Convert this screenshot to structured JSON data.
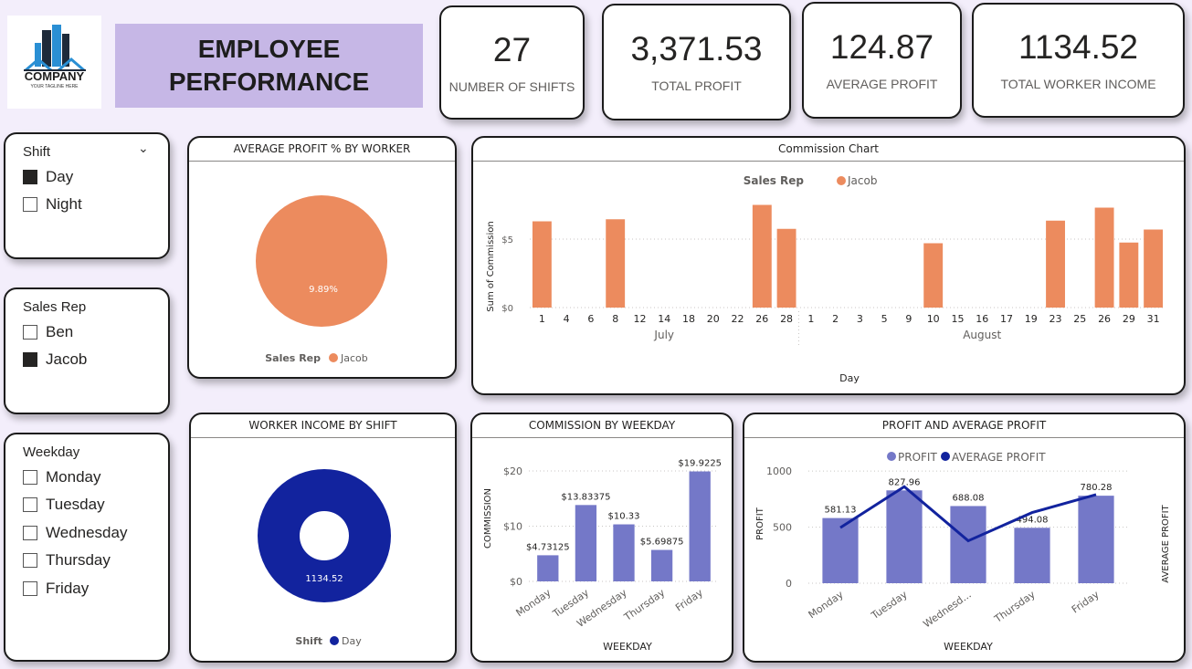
{
  "logo": {
    "name": "COMPANY",
    "tagline": "YOUR TAGLINE HERE"
  },
  "header": {
    "title_line1": "EMPLOYEE",
    "title_line2": "PERFORMANCE"
  },
  "kpis": [
    {
      "value": "27",
      "label": "NUMBER OF SHIFTS"
    },
    {
      "value": "3,371.53",
      "label": "TOTAL PROFIT"
    },
    {
      "value": "124.87",
      "label": "AVERAGE PROFIT"
    },
    {
      "value": "1134.52",
      "label": "TOTAL WORKER INCOME"
    }
  ],
  "slicers": {
    "shift": {
      "title": "Shift",
      "options": [
        {
          "label": "Day",
          "checked": true
        },
        {
          "label": "Night",
          "checked": false
        }
      ]
    },
    "sales_rep": {
      "title": "Sales Rep",
      "options": [
        {
          "label": "Ben",
          "checked": false
        },
        {
          "label": "Jacob",
          "checked": true
        }
      ]
    },
    "weekday": {
      "title": "Weekday",
      "options": [
        {
          "label": "Monday",
          "checked": false
        },
        {
          "label": "Tuesday",
          "checked": false
        },
        {
          "label": "Wednesday",
          "checked": false
        },
        {
          "label": "Thursday",
          "checked": false
        },
        {
          "label": "Friday",
          "checked": false
        }
      ]
    }
  },
  "colors": {
    "orange": "#ec8b5e",
    "navy": "#12239e",
    "purple_bar": "#7478c8",
    "title_bg": "#c6b7e6"
  },
  "chart_data": [
    {
      "id": "avg-profit-pie",
      "type": "pie",
      "title": "AVERAGE PROFIT % BY WORKER",
      "legend_title": "Sales Rep",
      "categories": [
        "Jacob"
      ],
      "values": [
        100
      ],
      "data_label": "9.89%",
      "colors": [
        "#ec8b5e"
      ]
    },
    {
      "id": "commission-chart",
      "type": "bar",
      "title": "Commission Chart",
      "legend_title": "Sales Rep",
      "series_name": "Jacob",
      "xlabel": "Day",
      "ylabel": "Sum of Commission",
      "ylim": [
        0,
        8
      ],
      "yticks": [
        {
          "v": 0,
          "label": "$0"
        },
        {
          "v": 5,
          "label": "$5"
        }
      ],
      "groups": [
        {
          "name": "July",
          "days": [
            {
              "d": "1",
              "v": 6.3
            },
            {
              "d": "4",
              "v": 0
            },
            {
              "d": "6",
              "v": 0
            },
            {
              "d": "8",
              "v": 6.45
            },
            {
              "d": "12",
              "v": 0
            },
            {
              "d": "14",
              "v": 0
            },
            {
              "d": "18",
              "v": 0
            },
            {
              "d": "20",
              "v": 0
            },
            {
              "d": "22",
              "v": 0
            },
            {
              "d": "26",
              "v": 7.5
            },
            {
              "d": "28",
              "v": 5.75
            }
          ]
        },
        {
          "name": "August",
          "days": [
            {
              "d": "1",
              "v": 0
            },
            {
              "d": "2",
              "v": 0
            },
            {
              "d": "3",
              "v": 0
            },
            {
              "d": "5",
              "v": 0
            },
            {
              "d": "9",
              "v": 0
            },
            {
              "d": "10",
              "v": 4.7
            },
            {
              "d": "15",
              "v": 0
            },
            {
              "d": "16",
              "v": 0
            },
            {
              "d": "17",
              "v": 0
            },
            {
              "d": "19",
              "v": 0
            },
            {
              "d": "23",
              "v": 6.35
            },
            {
              "d": "25",
              "v": 0
            },
            {
              "d": "26",
              "v": 7.3
            },
            {
              "d": "29",
              "v": 4.75
            },
            {
              "d": "31",
              "v": 5.7
            }
          ]
        }
      ],
      "grid": true
    },
    {
      "id": "worker-income-donut",
      "type": "pie",
      "title": "WORKER INCOME BY SHIFT",
      "legend_title": "Shift",
      "categories": [
        "Day"
      ],
      "values": [
        1134.52
      ],
      "data_label": "1134.52",
      "colors": [
        "#12239e"
      ]
    },
    {
      "id": "commission-by-weekday",
      "type": "bar",
      "title": "COMMISSION BY WEEKDAY",
      "xlabel": "WEEKDAY",
      "ylabel": "COMMISSION",
      "ylim": [
        0,
        21
      ],
      "yticks": [
        {
          "v": 0,
          "label": "$0"
        },
        {
          "v": 10,
          "label": "$10"
        },
        {
          "v": 20,
          "label": "$20"
        }
      ],
      "categories": [
        "Monday",
        "Tuesday",
        "Wednesday",
        "Thursday",
        "Friday"
      ],
      "values": [
        4.73125,
        13.83375,
        10.33,
        5.69875,
        19.9225
      ],
      "labels": [
        "$4.73125",
        "$13.83375",
        "$10.33",
        "$5.69875",
        "$19.9225"
      ],
      "grid": true
    },
    {
      "id": "profit-and-average-profit",
      "type": "bar",
      "title": "PROFIT AND AVERAGE PROFIT",
      "xlabel": "WEEKDAY",
      "ylabel": "PROFIT",
      "ylabel_right": "AVERAGE PROFIT",
      "ylim": [
        0,
        1050
      ],
      "yticks": [
        {
          "v": 0,
          "label": "0"
        },
        {
          "v": 500,
          "label": "500"
        },
        {
          "v": 1000,
          "label": "1000"
        }
      ],
      "categories": [
        "Monday",
        "Tuesday",
        "Wednesd...",
        "Thursday",
        "Friday"
      ],
      "series": [
        {
          "name": "PROFIT",
          "type": "bar",
          "values": [
            581.13,
            827.96,
            688.08,
            494.08,
            780.28
          ],
          "labels": [
            "581.13",
            "827.96",
            "688.08",
            "494.08",
            "780.28"
          ]
        },
        {
          "name": "AVERAGE PROFIT",
          "type": "line",
          "values": [
            118,
            205,
            90,
            150,
            188
          ],
          "ylim": [
            0,
            250
          ]
        }
      ],
      "grid": true
    }
  ]
}
